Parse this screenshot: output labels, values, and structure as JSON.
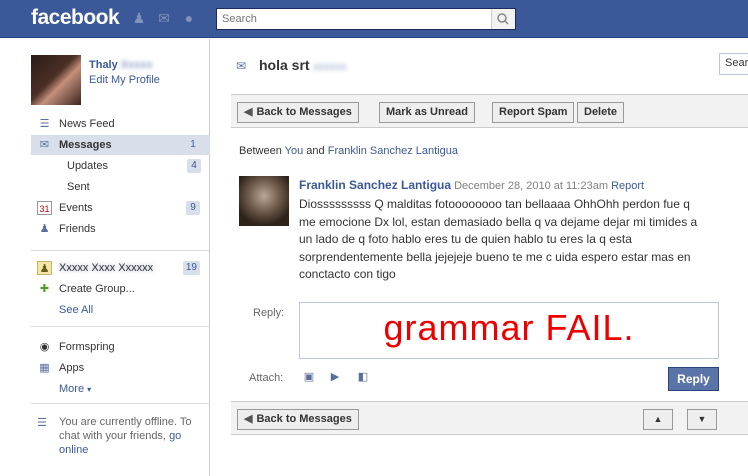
{
  "topbar": {
    "logo": "facebook",
    "search_placeholder": "Search"
  },
  "profile": {
    "name": "Thaly",
    "edit_label": "Edit My Profile"
  },
  "nav": {
    "news_feed": "News Feed",
    "messages": "Messages",
    "messages_count": "1",
    "updates": "Updates",
    "updates_count": "4",
    "sent": "Sent",
    "events": "Events",
    "events_count": "9",
    "friends": "Friends",
    "group_count": "19",
    "create_group": "Create Group...",
    "see_all": "See All",
    "formspring": "Formspring",
    "apps": "Apps",
    "more": "More"
  },
  "chat": {
    "offline_text": "You are currently offline. To chat with your friends,",
    "go_online": "go online"
  },
  "thread": {
    "title": "hola srt",
    "side_search": "Sear",
    "back_label": "Back to Messages",
    "mark_unread": "Mark as Unread",
    "report_spam": "Report Spam",
    "delete": "Delete",
    "between_prefix": "Between",
    "between_you": "You",
    "between_and": "and",
    "between_other": "Franklin Sanchez Lantigua"
  },
  "message": {
    "sender": "Franklin Sanchez Lantigua",
    "date": "December 28, 2010 at 11:23am",
    "report": "Report",
    "body": "Diosssssssss Q malditas fotoooooooo tan bellaaaa OhhOhh perdon fue q me emocione Dx lol, estan demasiado bella q va dejame dejar mi timides a un lado de q foto hablo eres tu de quien hablo tu eres la q esta sorprendentemente bella jejejeje bueno te me c uida espero estar mas en conctacto con tigo"
  },
  "reply": {
    "label": "Reply:",
    "text": "grammar FAIL.",
    "attach_label": "Attach:",
    "button": "Reply"
  }
}
